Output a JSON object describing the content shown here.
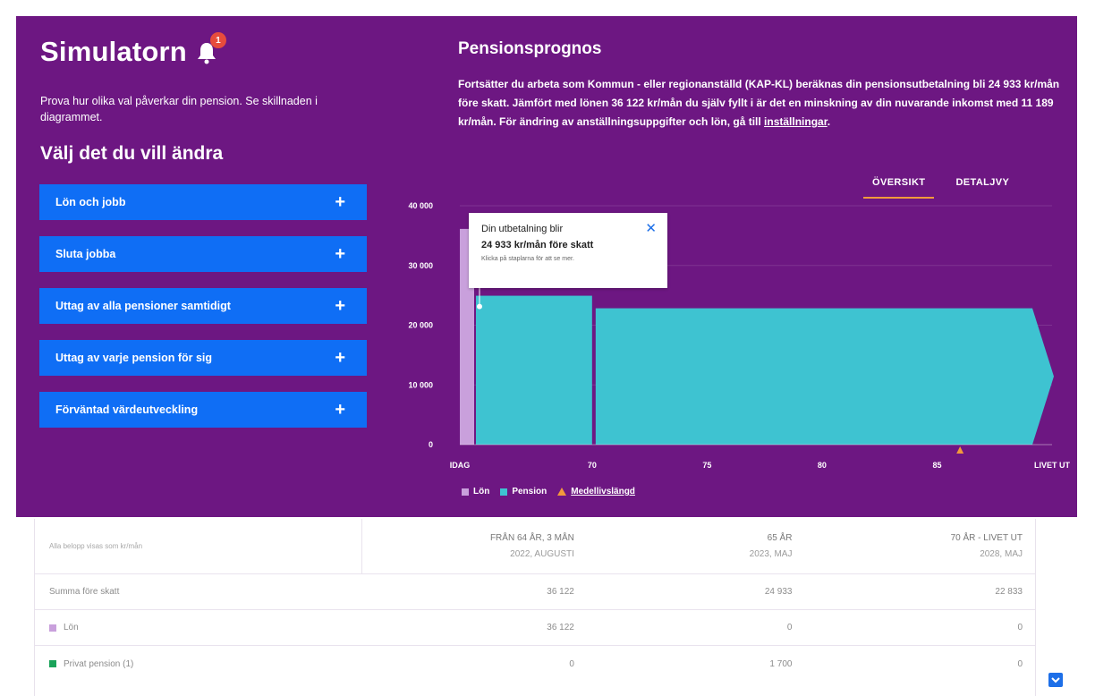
{
  "app": {
    "title": "Simulatorn",
    "notification_count": "1",
    "intro": "Prova hur olika val påverkar din pension. Se skillnaden i diagrammet.",
    "section_heading": "Välj det du vill ändra"
  },
  "menu": {
    "items": [
      {
        "label": "Lön och jobb"
      },
      {
        "label": "Sluta jobba"
      },
      {
        "label": "Uttag av alla pensioner samtidigt"
      },
      {
        "label": "Uttag av varje pension för sig"
      },
      {
        "label": "Förväntad värdeutveckling"
      }
    ],
    "plus_symbol": "+"
  },
  "prognos": {
    "title": "Pensionsprognos",
    "text_before_link": "Fortsätter du arbeta som Kommun - eller regionanställd (KAP-KL) beräknas din pensionsutbetalning bli 24 933 kr/mån före skatt. Jämfört med lönen 36 122 kr/mån du själv fyllt i är det en minskning av din nuvarande inkomst med 11 189 kr/mån. För ändring av anställningsuppgifter och lön, gå till ",
    "link_text": "inställningar",
    "text_after_link": "."
  },
  "tabs": [
    {
      "label": "ÖVERSIKT",
      "active": true
    },
    {
      "label": "DETALJVY",
      "active": false
    }
  ],
  "tooltip": {
    "line1": "Din utbetalning blir",
    "line2": "24 933 kr/mån före skatt",
    "line3": "Klicka på staplarna för att se mer.",
    "close": "✕"
  },
  "legend": [
    {
      "label": "Lön",
      "color": "#c9a0dc",
      "shape": "square"
    },
    {
      "label": "Pension",
      "color": "#3ec3d1",
      "shape": "square"
    },
    {
      "label": "Medellivslängd",
      "color": "#f29a3b",
      "shape": "triangle"
    }
  ],
  "colors": {
    "panel_bg": "#6d1782",
    "button_bg": "#0f6ef5",
    "accent_orange": "#f29a3b",
    "pension": "#3ec3d1",
    "salary": "#c9a0dc"
  },
  "chart_data": {
    "type": "area",
    "y_ticks": [
      "0",
      "10 000",
      "20 000",
      "30 000",
      "40 000"
    ],
    "ylim": [
      0,
      40000
    ],
    "x_ticks": [
      "IDAG",
      "70",
      "75",
      "80",
      "85",
      "LIVET UT"
    ],
    "series": [
      {
        "name": "Lön",
        "segments": [
          {
            "from": "IDAG",
            "to": "IDAG",
            "value": 36122
          }
        ]
      },
      {
        "name": "Pension",
        "segments": [
          {
            "from": "65",
            "to": "70",
            "value": 24933
          },
          {
            "from": "70",
            "to": "LIVET UT",
            "value": 22833
          }
        ]
      }
    ],
    "life_expectancy_marker": "86",
    "grid": true
  },
  "table": {
    "header_label": "Alla belopp visas som kr/mån",
    "columns": [
      {
        "title": "FRÅN 64 ÅR, 3 MÅN",
        "sub": "2022, AUGUSTI"
      },
      {
        "title": "65 ÅR",
        "sub": "2023, MAJ"
      },
      {
        "title": "70 ÅR - LIVET UT",
        "sub": "2028, MAJ"
      }
    ],
    "rows": [
      {
        "label": "Summa före skatt",
        "values": [
          "36 122",
          "24 933",
          "22 833"
        ],
        "swatch": ""
      },
      {
        "label": "Lön",
        "values": [
          "36 122",
          "0",
          "0"
        ],
        "swatch": "#c9a0dc"
      },
      {
        "label": "Privat pension (1)",
        "values": [
          "0",
          "1 700",
          "0"
        ],
        "swatch": "#1aa35a"
      }
    ]
  }
}
